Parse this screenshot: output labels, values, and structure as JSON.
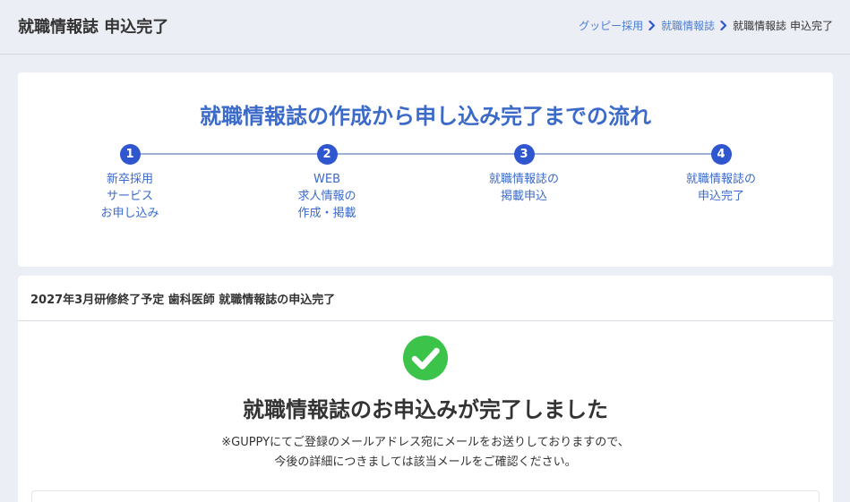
{
  "header": {
    "title": "就職情報誌 申込完了",
    "breadcrumb": [
      {
        "label": "グッピー採用",
        "link": true
      },
      {
        "label": "就職情報誌",
        "link": true
      },
      {
        "label": "就職情報誌 申込完了",
        "link": false
      }
    ]
  },
  "flow": {
    "title": "就職情報誌の作成から申し込み完了までの流れ",
    "steps": [
      {
        "num": "1",
        "label": "新卒採用\nサービス\nお申し込み"
      },
      {
        "num": "2",
        "label": "WEB\n求人情報の\n作成・掲載"
      },
      {
        "num": "3",
        "label": "就職情報誌の\n掲載申込"
      },
      {
        "num": "4",
        "label": "就職情報誌の\n申込完了"
      }
    ]
  },
  "completion": {
    "card_title": "2027年3月研修終了予定 歯科医師 就職情報誌の申込完了",
    "heading": "就職情報誌のお申込みが完了しました",
    "message": "※GUPPYにてご登録のメールアドレス宛にメールをお送りしておりますので、\n今後の詳細につきましては該当メールをご確認ください。"
  },
  "colors": {
    "accent": "#2f55cf",
    "link": "#4a7ed4",
    "success": "#3cc44a",
    "background": "#eceef5"
  },
  "icons": {
    "breadcrumb_separator": "chevron-right-icon",
    "success": "check-circle-icon"
  }
}
